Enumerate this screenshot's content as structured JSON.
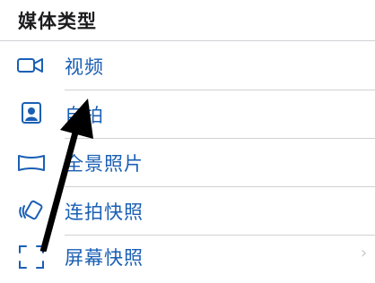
{
  "section": {
    "title": "媒体类型"
  },
  "items": [
    {
      "label": "视频",
      "icon": "video-camera-icon"
    },
    {
      "label": "自拍",
      "icon": "selfie-portrait-icon"
    },
    {
      "label": "全景照片",
      "icon": "panorama-icon"
    },
    {
      "label": "连拍快照",
      "icon": "burst-icon"
    },
    {
      "label": "屏幕快照",
      "icon": "screenshot-icon"
    }
  ],
  "colors": {
    "accent": "#1a5fb4",
    "divider": "#d1d1d6",
    "arrow": "#000000"
  }
}
